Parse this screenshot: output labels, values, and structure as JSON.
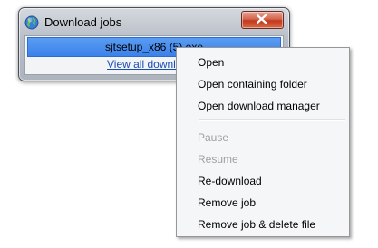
{
  "window": {
    "title": "Download jobs",
    "file_name": "sjtsetup_x86 (5).exe",
    "view_all_link": "View all downloads"
  },
  "context_menu": {
    "items": [
      {
        "label": "Open",
        "enabled": true
      },
      {
        "label": "Open containing folder",
        "enabled": true
      },
      {
        "label": "Open download manager",
        "enabled": true
      },
      {
        "label": "Pause",
        "enabled": false
      },
      {
        "label": "Resume",
        "enabled": false
      },
      {
        "label": "Re-download",
        "enabled": true
      },
      {
        "label": "Remove job",
        "enabled": true
      },
      {
        "label": "Remove job & delete file",
        "enabled": true
      }
    ]
  },
  "colors": {
    "selection_blue": "#3b82ea",
    "link_blue": "#1a4db3",
    "close_red": "#c4381d",
    "disabled_text": "#a0a0a0"
  },
  "icons": {
    "window_icon": "globe-icon",
    "close_icon": "close-icon"
  }
}
